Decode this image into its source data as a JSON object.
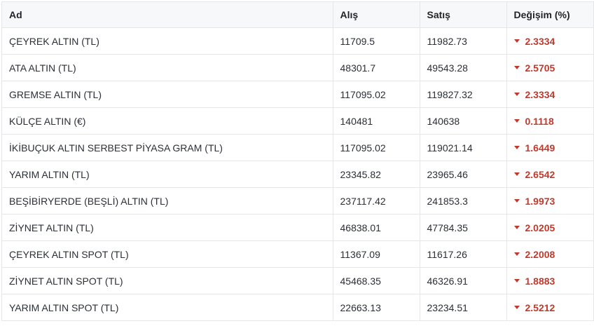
{
  "table": {
    "headers": {
      "name": "Ad",
      "buy": "Alış",
      "sell": "Satış",
      "change": "Değişim (%)"
    },
    "rows": [
      {
        "name": "ÇEYREK ALTIN (TL)",
        "buy": "11709.5",
        "sell": "11982.73",
        "change": "2.3334",
        "direction": "down"
      },
      {
        "name": "ATA ALTIN (TL)",
        "buy": "48301.7",
        "sell": "49543.28",
        "change": "2.5705",
        "direction": "down"
      },
      {
        "name": "GREMSE ALTIN (TL)",
        "buy": "117095.02",
        "sell": "119827.32",
        "change": "2.3334",
        "direction": "down"
      },
      {
        "name": "KÜLÇE ALTIN (€)",
        "buy": "140481",
        "sell": "140638",
        "change": "0.1118",
        "direction": "down"
      },
      {
        "name": "İKİBUÇUK ALTIN SERBEST PİYASA GRAM (TL)",
        "buy": "117095.02",
        "sell": "119021.14",
        "change": "1.6449",
        "direction": "down"
      },
      {
        "name": "YARIM ALTIN (TL)",
        "buy": "23345.82",
        "sell": "23965.46",
        "change": "2.6542",
        "direction": "down"
      },
      {
        "name": "BEŞİBİRYERDE (BEŞLİ) ALTIN (TL)",
        "buy": "237117.42",
        "sell": "241853.3",
        "change": "1.9973",
        "direction": "down"
      },
      {
        "name": "ZİYNET ALTIN (TL)",
        "buy": "46838.01",
        "sell": "47784.35",
        "change": "2.0205",
        "direction": "down"
      },
      {
        "name": "ÇEYREK ALTIN SPOT (TL)",
        "buy": "11367.09",
        "sell": "11617.26",
        "change": "2.2008",
        "direction": "down"
      },
      {
        "name": "ZİYNET ALTIN SPOT (TL)",
        "buy": "45468.35",
        "sell": "46326.91",
        "change": "1.8883",
        "direction": "down"
      },
      {
        "name": "YARIM ALTIN SPOT (TL)",
        "buy": "22663.13",
        "sell": "23234.51",
        "change": "2.5212",
        "direction": "down"
      }
    ]
  },
  "colors": {
    "change_down": "#c0392b",
    "header_bg": "#f7f8fa",
    "border": "#e4e6ea"
  },
  "icons": {
    "change_down": "caret-down-icon"
  }
}
